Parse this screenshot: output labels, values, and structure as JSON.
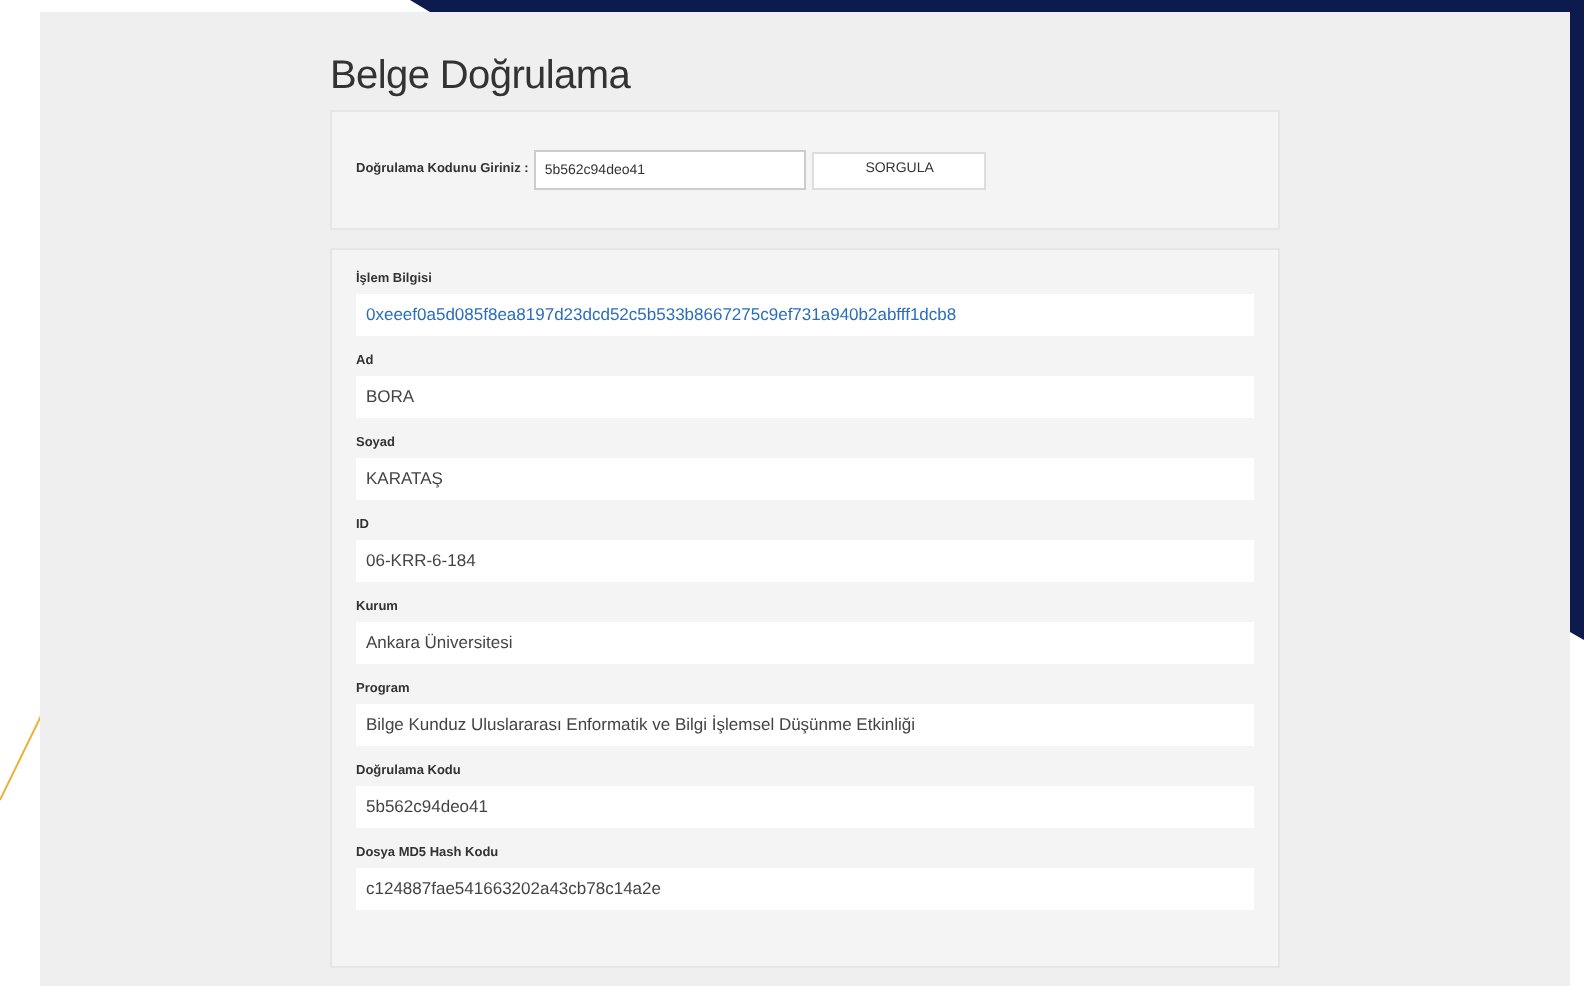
{
  "page": {
    "title": "Belge Doğrulama"
  },
  "query": {
    "label": "Doğrulama Kodunu Giriniz :",
    "value": "5b562c94deo41",
    "button": "SORGULA"
  },
  "fields": [
    {
      "label": "İşlem Bilgisi",
      "value": "0xeeef0a5d085f8ea8197d23dcd52c5b533b8667275c9ef731a940b2abfff1dcb8",
      "kind": "link"
    },
    {
      "label": "Ad",
      "value": "BORA",
      "kind": "text"
    },
    {
      "label": "Soyad",
      "value": "KARATAŞ",
      "kind": "text"
    },
    {
      "label": "ID",
      "value": "06-KRR-6-184",
      "kind": "text"
    },
    {
      "label": "Kurum",
      "value": "Ankara Üniversitesi",
      "kind": "text"
    },
    {
      "label": "Program",
      "value": "Bilge Kunduz Uluslararası Enformatik ve Bilgi İşlemsel Düşünme Etkinliği",
      "kind": "text"
    },
    {
      "label": "Doğrulama Kodu",
      "value": "5b562c94deo41",
      "kind": "text"
    },
    {
      "label": "Dosya MD5 Hash Kodu",
      "value": "c124887fae541663202a43cb78c14a2e",
      "kind": "text"
    }
  ]
}
